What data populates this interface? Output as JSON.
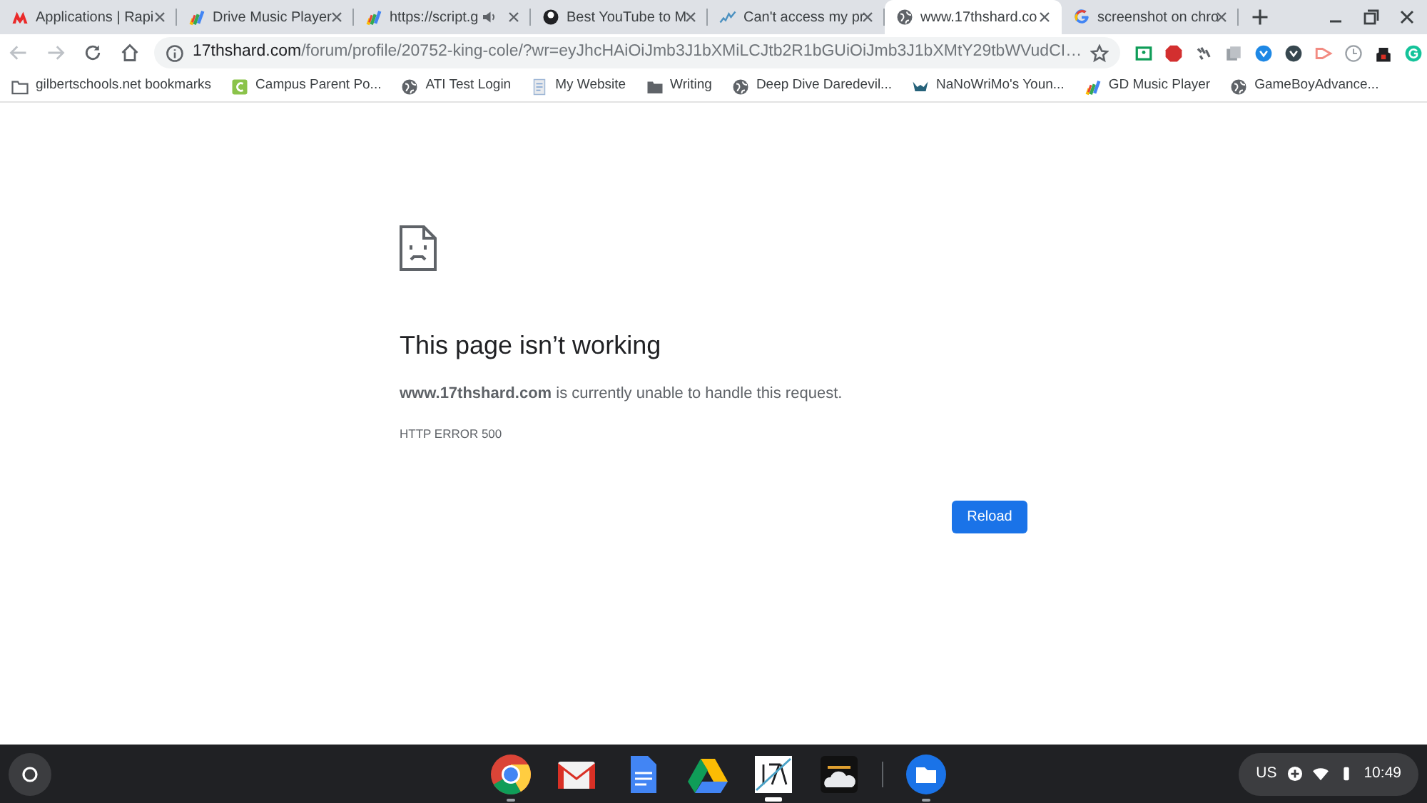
{
  "tabs": [
    {
      "title": "Applications | Rapi",
      "selected": false,
      "audio": false
    },
    {
      "title": "Drive Music Player",
      "selected": false,
      "audio": false
    },
    {
      "title": "https://script.g",
      "selected": false,
      "audio": true
    },
    {
      "title": "Best YouTube to M",
      "selected": false,
      "audio": false
    },
    {
      "title": "Can't access my pr",
      "selected": false,
      "audio": false
    },
    {
      "title": "www.17thshard.co",
      "selected": true,
      "audio": false
    },
    {
      "title": "screenshot on chro",
      "selected": false,
      "audio": false
    }
  ],
  "omnibox": {
    "host": "17thshard.com",
    "path": "/forum/profile/20752-king-cole/?wr=eyJhcHAiOiJmb3J1bXMiLCJtb2R1bGUiOiJmb3J1bXMtY29tbWVudCI…"
  },
  "bookmarks": [
    {
      "label": "gilbertschools.net bookmarks"
    },
    {
      "label": "Campus Parent Po..."
    },
    {
      "label": "ATI Test Login"
    },
    {
      "label": "My Website"
    },
    {
      "label": "Writing"
    },
    {
      "label": "Deep Dive Daredevil..."
    },
    {
      "label": "NaNoWriMo's Youn..."
    },
    {
      "label": "GD Music Player"
    },
    {
      "label": "GameBoyAdvance..."
    }
  ],
  "error_page": {
    "title": "This page isn’t working",
    "message": "**www.17thshard.com** is currently unable to handle this request.",
    "code": "HTTP ERROR 500",
    "button": "Reload"
  },
  "shelf": {
    "apps": [
      {
        "running": true,
        "active": false
      },
      {
        "running": false,
        "active": false
      },
      {
        "running": false,
        "active": false
      },
      {
        "running": false,
        "active": false
      },
      {
        "running": true,
        "active": true
      },
      {
        "running": false,
        "active": false
      },
      {
        "running": true,
        "active": false
      }
    ],
    "ime": "US",
    "time": "10:49"
  }
}
